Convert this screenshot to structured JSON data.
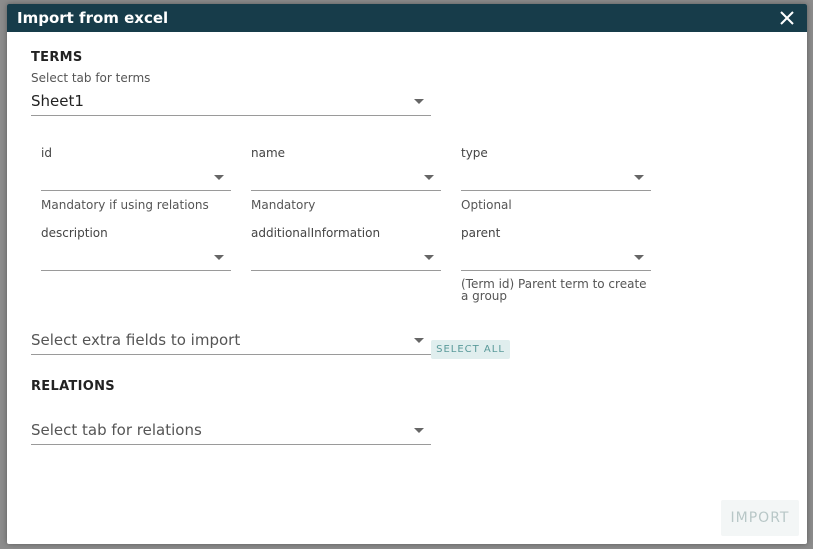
{
  "dialog": {
    "title": "Import from excel"
  },
  "terms": {
    "heading": "TERMS",
    "tab_label": "Select tab for terms",
    "tab_value": "Sheet1",
    "fields": [
      {
        "label": "id",
        "helper": "Mandatory if using relations"
      },
      {
        "label": "name",
        "helper": "Mandatory"
      },
      {
        "label": "type",
        "helper": "Optional"
      },
      {
        "label": "description",
        "helper": ""
      },
      {
        "label": "additionalInformation",
        "helper": ""
      },
      {
        "label": "parent",
        "helper": "(Term id) Parent term to create a group"
      }
    ],
    "extra_fields_placeholder": "Select extra fields to import",
    "select_all_label": "SELECT ALL"
  },
  "relations": {
    "heading": "RELATIONS",
    "tab_placeholder": "Select tab for relations"
  },
  "footer": {
    "import_label": "IMPORT"
  }
}
